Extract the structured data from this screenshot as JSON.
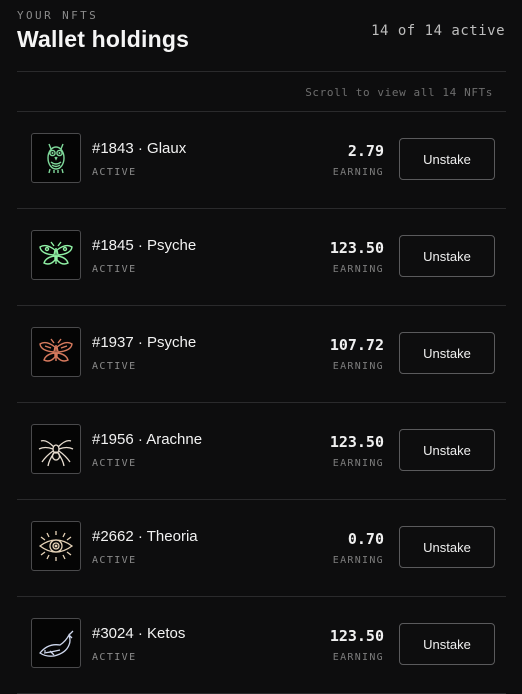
{
  "header": {
    "eyebrow": "YOUR NFTS",
    "title": "Wallet holdings",
    "count": "14 of 14 active"
  },
  "hint": "Scroll to view all 14 NFTs",
  "colors": {
    "background": "#0d0d0e",
    "owl": "#7fd89a",
    "butterfly_green": "#8ff0a4",
    "butterfly_red": "#d77a5e",
    "spider": "#e8ddd0",
    "eye": "#e6d3b8",
    "whale": "#cfd8ee"
  },
  "items": [
    {
      "name": "#1843 · Glaux",
      "status": "ACTIVE",
      "amount": "2.79",
      "earning_label": "EARNING",
      "button": "Unstake",
      "icon": "owl-icon"
    },
    {
      "name": "#1845 · Psyche",
      "status": "ACTIVE",
      "amount": "123.50",
      "earning_label": "EARNING",
      "button": "Unstake",
      "icon": "butterfly-icon"
    },
    {
      "name": "#1937 · Psyche",
      "status": "ACTIVE",
      "amount": "107.72",
      "earning_label": "EARNING",
      "button": "Unstake",
      "icon": "butterfly-icon"
    },
    {
      "name": "#1956 · Arachne",
      "status": "ACTIVE",
      "amount": "123.50",
      "earning_label": "EARNING",
      "button": "Unstake",
      "icon": "spider-icon"
    },
    {
      "name": "#2662 · Theoria",
      "status": "ACTIVE",
      "amount": "0.70",
      "earning_label": "EARNING",
      "button": "Unstake",
      "icon": "eye-icon"
    },
    {
      "name": "#3024 · Ketos",
      "status": "ACTIVE",
      "amount": "123.50",
      "earning_label": "EARNING",
      "button": "Unstake",
      "icon": "whale-icon"
    }
  ]
}
